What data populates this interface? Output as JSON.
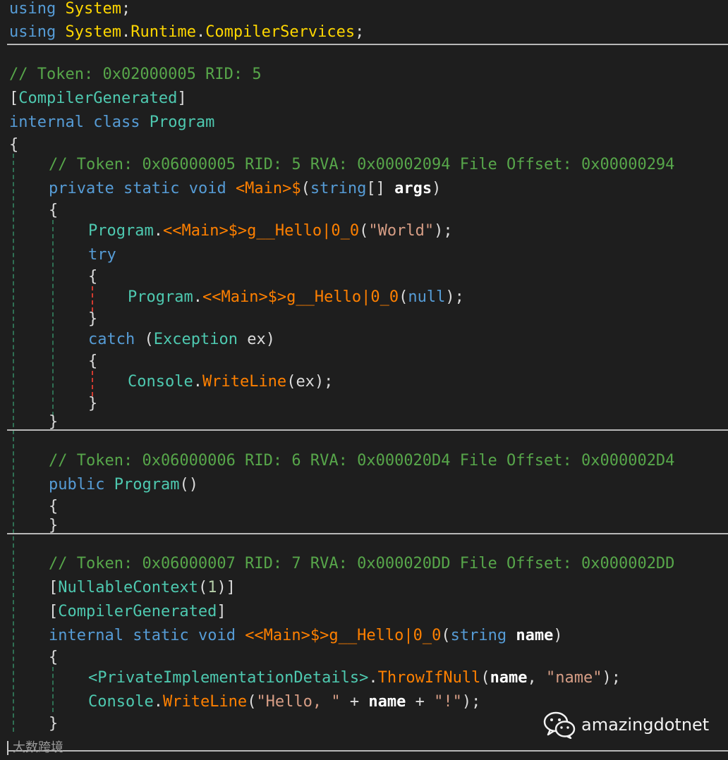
{
  "editor": {
    "lines": {
      "l1": [
        {
          "cls": "t-kw",
          "text": "using"
        },
        {
          "cls": "t-plain",
          "text": " "
        },
        {
          "cls": "t-ns",
          "text": "System"
        },
        {
          "cls": "t-punct",
          "text": ";"
        }
      ],
      "l2": [
        {
          "cls": "t-kw",
          "text": "using"
        },
        {
          "cls": "t-plain",
          "text": " "
        },
        {
          "cls": "t-ns",
          "text": "System"
        },
        {
          "cls": "t-punct",
          "text": "."
        },
        {
          "cls": "t-ns",
          "text": "Runtime"
        },
        {
          "cls": "t-punct",
          "text": "."
        },
        {
          "cls": "t-ns",
          "text": "CompilerServices"
        },
        {
          "cls": "t-punct",
          "text": ";"
        }
      ],
      "l3": [
        {
          "cls": "t-comment",
          "text": "// Token: 0x02000005 RID: 5"
        }
      ],
      "l4": [
        {
          "cls": "t-punct",
          "text": "["
        },
        {
          "cls": "t-type",
          "text": "CompilerGenerated"
        },
        {
          "cls": "t-punct",
          "text": "]"
        }
      ],
      "l5": [
        {
          "cls": "t-kw",
          "text": "internal"
        },
        {
          "cls": "t-plain",
          "text": " "
        },
        {
          "cls": "t-kw",
          "text": "class"
        },
        {
          "cls": "t-plain",
          "text": " "
        },
        {
          "cls": "t-type",
          "text": "Program"
        }
      ],
      "l6": [
        {
          "cls": "t-punct",
          "text": "{"
        }
      ],
      "l7": [
        {
          "cls": "t-comment",
          "text": "// Token: 0x06000005 RID: 5 RVA: 0x00002094 File Offset: 0x00000294"
        }
      ],
      "l8": [
        {
          "cls": "t-kw",
          "text": "private"
        },
        {
          "cls": "t-plain",
          "text": " "
        },
        {
          "cls": "t-kw",
          "text": "static"
        },
        {
          "cls": "t-plain",
          "text": " "
        },
        {
          "cls": "t-kw",
          "text": "void"
        },
        {
          "cls": "t-plain",
          "text": " "
        },
        {
          "cls": "t-gen",
          "text": "<Main>$"
        },
        {
          "cls": "t-punct",
          "text": "("
        },
        {
          "cls": "t-kw",
          "text": "string"
        },
        {
          "cls": "t-punct",
          "text": "[] "
        },
        {
          "cls": "t-param",
          "text": "args"
        },
        {
          "cls": "t-punct",
          "text": ")"
        }
      ],
      "l9": [
        {
          "cls": "t-punct",
          "text": "{"
        }
      ],
      "l10": [
        {
          "cls": "t-type",
          "text": "Program"
        },
        {
          "cls": "t-punct",
          "text": "."
        },
        {
          "cls": "t-gen",
          "text": "<<Main>$>g__Hello|0_0"
        },
        {
          "cls": "t-punct",
          "text": "("
        },
        {
          "cls": "t-str",
          "text": "\"World\""
        },
        {
          "cls": "t-punct",
          "text": ");"
        }
      ],
      "l11": [
        {
          "cls": "t-ctrl",
          "text": "try"
        }
      ],
      "l12": [
        {
          "cls": "t-punct",
          "text": "{"
        }
      ],
      "l13": [
        {
          "cls": "t-type",
          "text": "Program"
        },
        {
          "cls": "t-punct",
          "text": "."
        },
        {
          "cls": "t-gen",
          "text": "<<Main>$>g__Hello|0_0"
        },
        {
          "cls": "t-punct",
          "text": "("
        },
        {
          "cls": "t-kw",
          "text": "null"
        },
        {
          "cls": "t-punct",
          "text": ");"
        }
      ],
      "l14": [
        {
          "cls": "t-punct",
          "text": "}"
        }
      ],
      "l15": [
        {
          "cls": "t-ctrl",
          "text": "catch"
        },
        {
          "cls": "t-plain",
          "text": " "
        },
        {
          "cls": "t-punct",
          "text": "("
        },
        {
          "cls": "t-type",
          "text": "Exception"
        },
        {
          "cls": "t-plain",
          "text": " ex"
        },
        {
          "cls": "t-punct",
          "text": ")"
        }
      ],
      "l16": [
        {
          "cls": "t-punct",
          "text": "{"
        }
      ],
      "l17": [
        {
          "cls": "t-type",
          "text": "Console"
        },
        {
          "cls": "t-punct",
          "text": "."
        },
        {
          "cls": "t-method",
          "text": "WriteLine"
        },
        {
          "cls": "t-punct",
          "text": "("
        },
        {
          "cls": "t-plain",
          "text": "ex"
        },
        {
          "cls": "t-punct",
          "text": ");"
        }
      ],
      "l18": [
        {
          "cls": "t-punct",
          "text": "}"
        }
      ],
      "l19": [
        {
          "cls": "t-punct",
          "text": "}"
        }
      ],
      "l20": [
        {
          "cls": "t-comment",
          "text": "// Token: 0x06000006 RID: 6 RVA: 0x000020D4 File Offset: 0x000002D4"
        }
      ],
      "l21": [
        {
          "cls": "t-kw",
          "text": "public"
        },
        {
          "cls": "t-plain",
          "text": " "
        },
        {
          "cls": "t-type",
          "text": "Program"
        },
        {
          "cls": "t-punct",
          "text": "()"
        }
      ],
      "l22": [
        {
          "cls": "t-punct",
          "text": "{"
        }
      ],
      "l23": [
        {
          "cls": "t-punct",
          "text": "}"
        }
      ],
      "l24": [
        {
          "cls": "t-comment",
          "text": "// Token: 0x06000007 RID: 7 RVA: 0x000020DD File Offset: 0x000002DD"
        }
      ],
      "l25": [
        {
          "cls": "t-punct",
          "text": "["
        },
        {
          "cls": "t-type",
          "text": "NullableContext"
        },
        {
          "cls": "t-punct",
          "text": "("
        },
        {
          "cls": "t-num",
          "text": "1"
        },
        {
          "cls": "t-punct",
          "text": ")]"
        }
      ],
      "l26": [
        {
          "cls": "t-punct",
          "text": "["
        },
        {
          "cls": "t-type",
          "text": "CompilerGenerated"
        },
        {
          "cls": "t-punct",
          "text": "]"
        }
      ],
      "l27": [
        {
          "cls": "t-kw",
          "text": "internal"
        },
        {
          "cls": "t-plain",
          "text": " "
        },
        {
          "cls": "t-kw",
          "text": "static"
        },
        {
          "cls": "t-plain",
          "text": " "
        },
        {
          "cls": "t-kw",
          "text": "void"
        },
        {
          "cls": "t-plain",
          "text": " "
        },
        {
          "cls": "t-gen",
          "text": "<<Main>$>g__Hello|0_0"
        },
        {
          "cls": "t-punct",
          "text": "("
        },
        {
          "cls": "t-kw",
          "text": "string"
        },
        {
          "cls": "t-plain",
          "text": " "
        },
        {
          "cls": "t-param",
          "text": "name"
        },
        {
          "cls": "t-punct",
          "text": ")"
        }
      ],
      "l28": [
        {
          "cls": "t-punct",
          "text": "{"
        }
      ],
      "l29": [
        {
          "cls": "t-type",
          "text": "<PrivateImplementationDetails>"
        },
        {
          "cls": "t-punct",
          "text": "."
        },
        {
          "cls": "t-method",
          "text": "ThrowIfNull"
        },
        {
          "cls": "t-punct",
          "text": "("
        },
        {
          "cls": "t-param",
          "text": "name"
        },
        {
          "cls": "t-punct",
          "text": ", "
        },
        {
          "cls": "t-str",
          "text": "\"name\""
        },
        {
          "cls": "t-punct",
          "text": ");"
        }
      ],
      "l30": [
        {
          "cls": "t-type",
          "text": "Console"
        },
        {
          "cls": "t-punct",
          "text": "."
        },
        {
          "cls": "t-method",
          "text": "WriteLine"
        },
        {
          "cls": "t-punct",
          "text": "("
        },
        {
          "cls": "t-str",
          "text": "\"Hello, \""
        },
        {
          "cls": "t-punct",
          "text": " + "
        },
        {
          "cls": "t-param",
          "text": "name"
        },
        {
          "cls": "t-punct",
          "text": " + "
        },
        {
          "cls": "t-str",
          "text": "\"!\""
        },
        {
          "cls": "t-punct",
          "text": ");"
        }
      ],
      "l31": [
        {
          "cls": "t-punct",
          "text": "}"
        }
      ]
    }
  },
  "watermark": {
    "icon": "wechat-icon",
    "account": "amazingdotnet"
  },
  "corner_mark": {
    "text": "大数跨境"
  }
}
